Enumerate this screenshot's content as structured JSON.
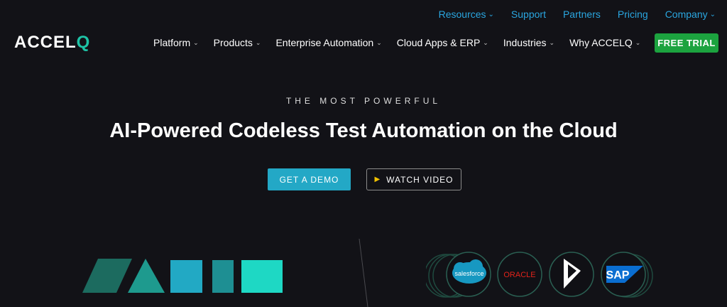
{
  "top_links": [
    {
      "label": "Resources",
      "has_dropdown": true
    },
    {
      "label": "Support",
      "has_dropdown": false
    },
    {
      "label": "Partners",
      "has_dropdown": false
    },
    {
      "label": "Pricing",
      "has_dropdown": false
    },
    {
      "label": "Company",
      "has_dropdown": true
    }
  ],
  "logo": {
    "main": "ACCEL",
    "accent": "Q"
  },
  "nav": [
    {
      "label": "Platform"
    },
    {
      "label": "Products"
    },
    {
      "label": "Enterprise Automation"
    },
    {
      "label": "Cloud Apps & ERP"
    },
    {
      "label": "Industries"
    },
    {
      "label": "Why ACCELQ"
    }
  ],
  "free_trial_label": "FREE TRIAL",
  "hero": {
    "eyebrow": "THE MOST POWERFUL",
    "headline": "AI-Powered Codeless Test Automation on the Cloud",
    "cta_primary": "GET A DEMO",
    "cta_secondary": "WATCH VIDEO"
  },
  "partner_logos": [
    {
      "name": "salesforce",
      "label": "salesforce"
    },
    {
      "name": "oracle",
      "label": "ORACLE"
    },
    {
      "name": "dynamics",
      "label": ""
    },
    {
      "name": "sap",
      "label": "SAP"
    }
  ],
  "colors": {
    "background": "#121217",
    "link": "#2aa6e0",
    "accent_teal": "#1ec3a6",
    "demo_button": "#23a8c6",
    "trial_button": "#1ca33f",
    "play_icon": "#f2c200",
    "oracle_red": "#e2231a",
    "salesforce_blue": "#1798c1",
    "sap_blue": "#0a6ed1"
  },
  "icons": {
    "dropdown": "chevron-down-icon",
    "play": "play-icon"
  }
}
